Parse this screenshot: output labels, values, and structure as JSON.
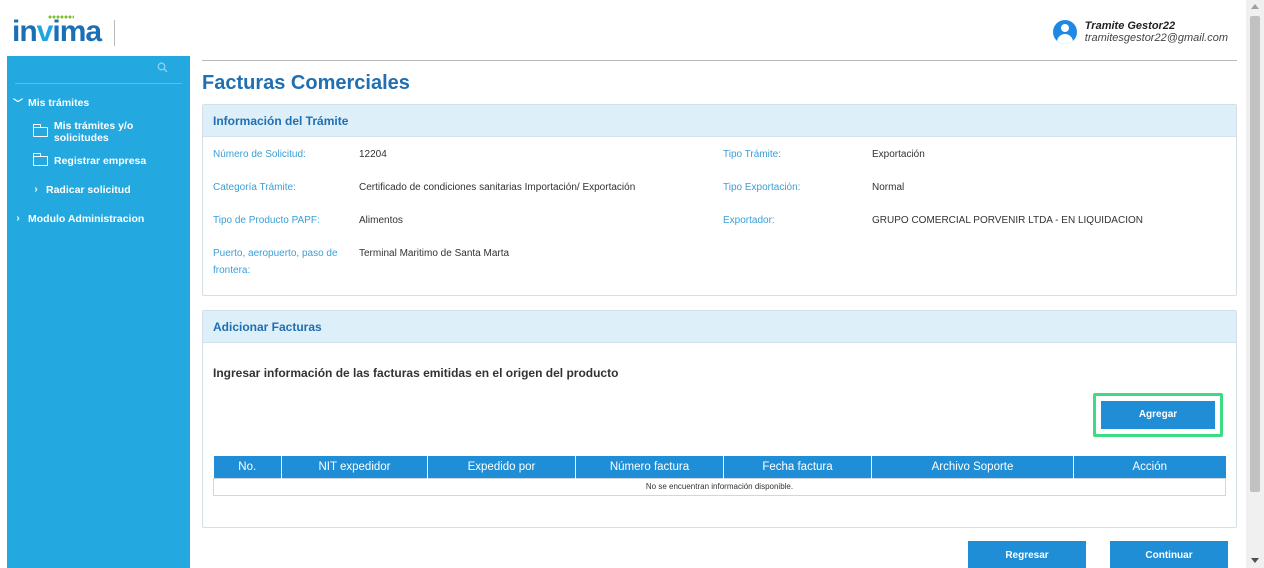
{
  "logo": {
    "text_in": "in",
    "text_v": "v",
    "text_rest": "ima"
  },
  "user": {
    "name": "Tramite Gestor22",
    "email": "tramitesgestor22@gmail.com"
  },
  "sidebar": {
    "items": [
      {
        "label": "Mis trámites",
        "chevron": "﹀"
      },
      {
        "label": "Mis trámites y/o solicitudes"
      },
      {
        "label": "Registrar empresa"
      },
      {
        "label": "Radicar solicitud",
        "chevron": "›"
      },
      {
        "label": "Modulo Administracion",
        "chevron": "›"
      }
    ]
  },
  "page": {
    "title": "Facturas Comerciales"
  },
  "info_panel": {
    "title": "Información del Trámite",
    "fields": {
      "numero_solicitud": {
        "label": "Número de Solicitud:",
        "value": "12204"
      },
      "tipo_tramite": {
        "label": "Tipo Trámite:",
        "value": "Exportación"
      },
      "categoria_tramite": {
        "label": "Categoría Trámite:",
        "value": "Certificado de condiciones sanitarias Importación/ Exportación"
      },
      "tipo_exportacion": {
        "label": "Tipo Exportación:",
        "value": "Normal"
      },
      "tipo_producto": {
        "label": "Tipo de Producto PAPF:",
        "value": "Alimentos"
      },
      "exportador": {
        "label": "Exportador:",
        "value": "GRUPO COMERCIAL PORVENIR LTDA - EN LIQUIDACION"
      },
      "puerto_line1": {
        "label": "Puerto, aeropuerto, paso de"
      },
      "puerto_line2": {
        "label": "frontera:"
      },
      "puerto": {
        "value": "Terminal Maritimo de Santa Marta"
      }
    }
  },
  "facturas_panel": {
    "title": "Adicionar Facturas",
    "subtitle": "Ingresar información de las facturas emitidas en el origen del producto",
    "add_button": "Agregar",
    "table": {
      "columns": [
        "No.",
        "NIT expedidor",
        "Expedido por",
        "Número factura",
        "Fecha factura",
        "Archivo Soporte",
        "Acción"
      ],
      "empty_message": "No se encuentran información disponible."
    }
  },
  "footer": {
    "back_button": "Regresar",
    "continue_button": "Continuar"
  },
  "colors": {
    "sidebar": "#23a8df",
    "primary_button": "#1f8ed6",
    "title": "#1f6fb2",
    "label": "#3b9fd6",
    "focus_ring": "#3ddc84"
  }
}
